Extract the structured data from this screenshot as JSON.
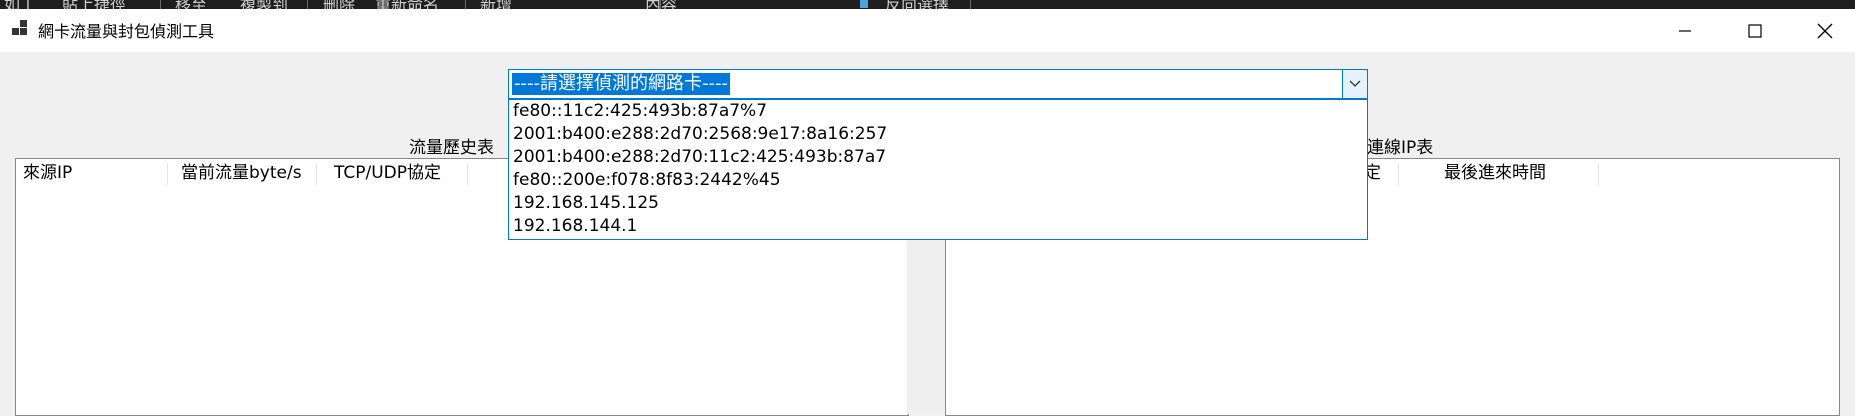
{
  "background_taskbar": {
    "items": [
      "如工",
      "貼上捷徑",
      "移至",
      "複製到",
      "刪除",
      "重新命名",
      "新增",
      "內容",
      "反向選擇"
    ]
  },
  "window": {
    "title": "網卡流量與封包偵測工具",
    "controls": {
      "minimize": "—",
      "maximize": "☐",
      "close": "✕"
    }
  },
  "adapter_select": {
    "selected": "----請選擇偵測的網路卡----",
    "options": [
      "fe80::11c2:425:493b:87a7%7",
      "2001:b400:e288:2d70:2568:9e17:8a16:257",
      "2001:b400:e288:2d70:11c2:425:493b:87a7",
      "fe80::200e:f078:8f83:2442%45",
      "192.168.145.125",
      "192.168.144.1"
    ]
  },
  "left_panel": {
    "label": "流量歷史表",
    "columns": [
      "來源IP",
      "當前流量byte/s",
      "TCP/UDP協定"
    ]
  },
  "right_panel": {
    "label": "連線IP表",
    "columns": [
      "定",
      "最後進來時間"
    ]
  }
}
